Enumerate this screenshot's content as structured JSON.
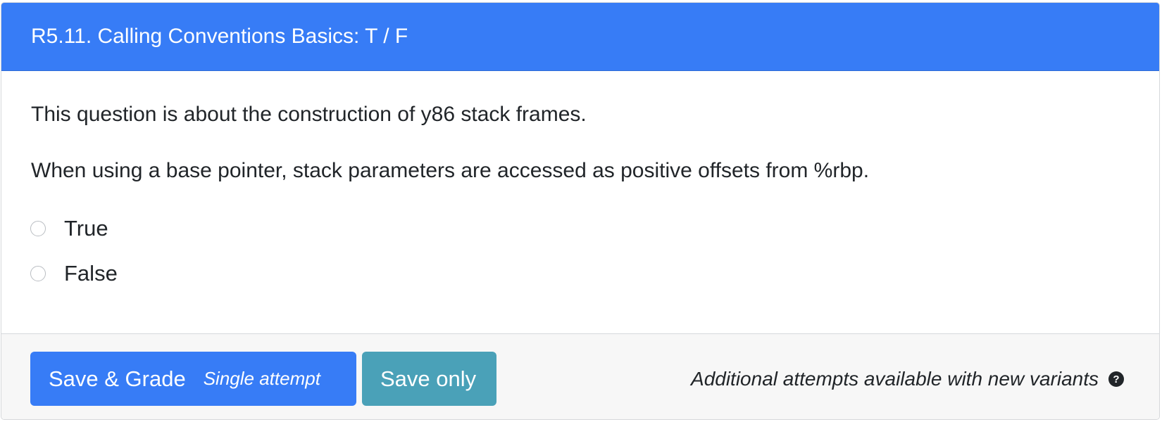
{
  "header": {
    "title": "R5.11. Calling Conventions Basics: T / F"
  },
  "body": {
    "paragraphs": [
      "This question is about the construction of y86 stack frames.",
      "When using a base pointer, stack parameters are accessed as positive offsets from %rbp."
    ],
    "options": [
      {
        "label": "True",
        "selected": false
      },
      {
        "label": "False",
        "selected": false
      }
    ]
  },
  "footer": {
    "grade_button": {
      "label": "Save & Grade",
      "sub_label": "Single attempt"
    },
    "save_button": {
      "label": "Save only"
    },
    "note": "Additional attempts available with new variants",
    "help_icon": "?"
  },
  "colors": {
    "primary": "#377cf6",
    "info": "#4aa1b8",
    "footer_bg": "#f7f7f7"
  }
}
